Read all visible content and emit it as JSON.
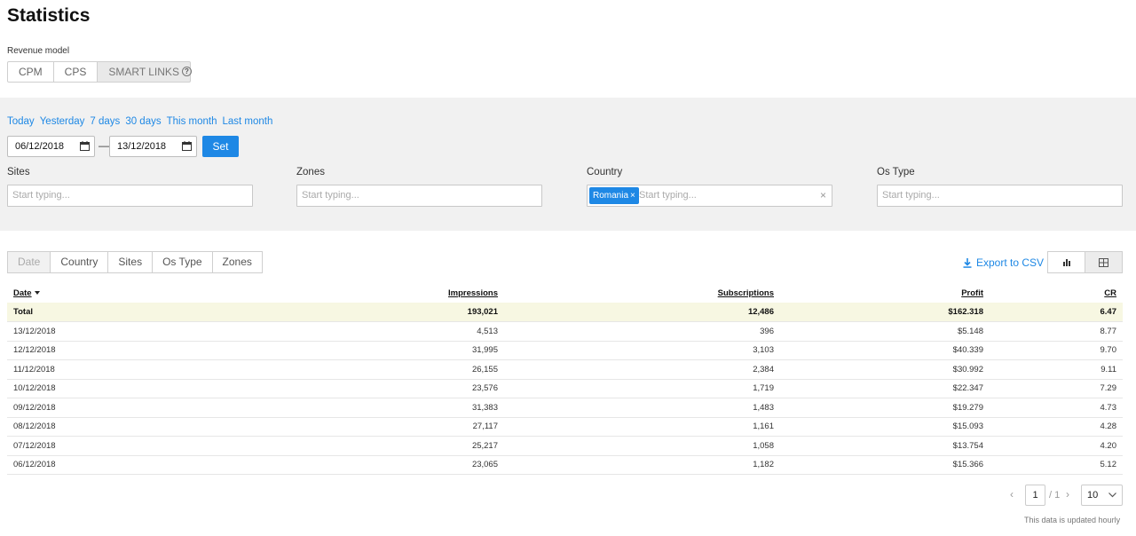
{
  "page": {
    "title": "Statistics"
  },
  "revenue_model": {
    "label": "Revenue model",
    "options": [
      "CPM",
      "CPS",
      "SMART LINKS"
    ],
    "selected": "SMART LINKS",
    "help_icon": "question-circle-icon"
  },
  "filters": {
    "quick_ranges": [
      "Today",
      "Yesterday",
      "7 days",
      "30 days",
      "This month",
      "Last month"
    ],
    "date_from": "06/12/2018",
    "date_to": "13/12/2018",
    "separator": "—",
    "set_label": "Set",
    "sites": {
      "label": "Sites",
      "placeholder": "Start typing..."
    },
    "zones": {
      "label": "Zones",
      "placeholder": "Start typing..."
    },
    "country": {
      "label": "Country",
      "placeholder": "Start typing...",
      "chips": [
        "Romania"
      ],
      "chip_remove": "×",
      "clear": "×"
    },
    "os_type": {
      "label": "Os Type",
      "placeholder": "Start typing..."
    }
  },
  "group_tabs": [
    "Date",
    "Country",
    "Sites",
    "Os Type",
    "Zones"
  ],
  "export_label": "Export to CSV",
  "view_icons": [
    "bar-chart-icon",
    "grid-table-icon"
  ],
  "table": {
    "headers": [
      "Date",
      "Impressions",
      "Subscriptions",
      "Profit",
      "CR"
    ],
    "total": [
      "Total",
      "193,021",
      "12,486",
      "$162.318",
      "6.47"
    ],
    "rows": [
      [
        "13/12/2018",
        "4,513",
        "396",
        "$5.148",
        "8.77"
      ],
      [
        "12/12/2018",
        "31,995",
        "3,103",
        "$40.339",
        "9.70"
      ],
      [
        "11/12/2018",
        "26,155",
        "2,384",
        "$30.992",
        "9.11"
      ],
      [
        "10/12/2018",
        "23,576",
        "1,719",
        "$22.347",
        "7.29"
      ],
      [
        "09/12/2018",
        "31,383",
        "1,483",
        "$19.279",
        "4.73"
      ],
      [
        "08/12/2018",
        "27,117",
        "1,161",
        "$15.093",
        "4.28"
      ],
      [
        "07/12/2018",
        "25,217",
        "1,058",
        "$13.754",
        "4.20"
      ],
      [
        "06/12/2018",
        "23,065",
        "1,182",
        "$15.366",
        "5.12"
      ]
    ]
  },
  "pagination": {
    "page": "1",
    "of": "/ 1",
    "per_page": "10",
    "prev": "‹",
    "next": "›"
  },
  "note": "This data is updated hourly",
  "colors": {
    "accent": "#1e88e5",
    "filter_bg": "#f1f1f1",
    "total_row_bg": "#f7f7e2"
  }
}
